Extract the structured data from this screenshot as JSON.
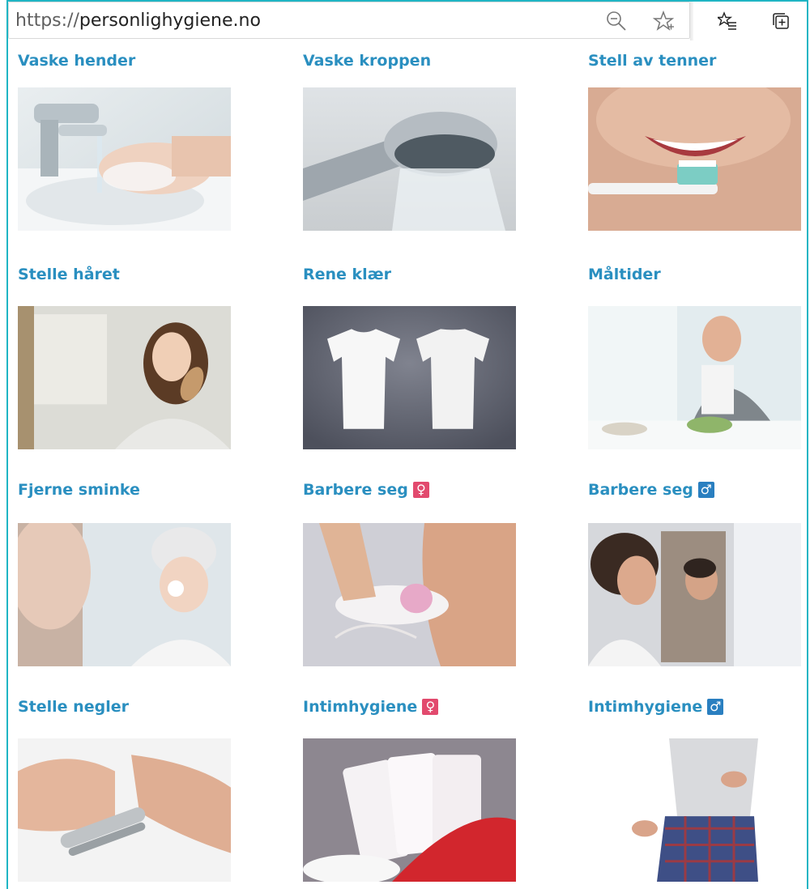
{
  "browser": {
    "url_protocol": "https://",
    "url_host": "personlighygiene.no"
  },
  "colors": {
    "title": "#2a8fc0",
    "female_badge": "#e24a6e",
    "male_badge": "#2a7fc0",
    "frame": "#1fb5c4"
  },
  "tiles": [
    {
      "title": "Vaske hender",
      "badge": ""
    },
    {
      "title": "Vaske kroppen",
      "badge": ""
    },
    {
      "title": "Stell av tenner",
      "badge": ""
    },
    {
      "title": "Stelle håret",
      "badge": ""
    },
    {
      "title": "Rene klær",
      "badge": ""
    },
    {
      "title": "Måltider",
      "badge": ""
    },
    {
      "title": "Fjerne sminke",
      "badge": ""
    },
    {
      "title": "Barbere seg",
      "badge": "♀"
    },
    {
      "title": "Barbere seg",
      "badge": "♂"
    },
    {
      "title": "Stelle negler",
      "badge": ""
    },
    {
      "title": "Intimhygiene",
      "badge": "♀"
    },
    {
      "title": "Intimhygiene",
      "badge": "♂"
    }
  ]
}
